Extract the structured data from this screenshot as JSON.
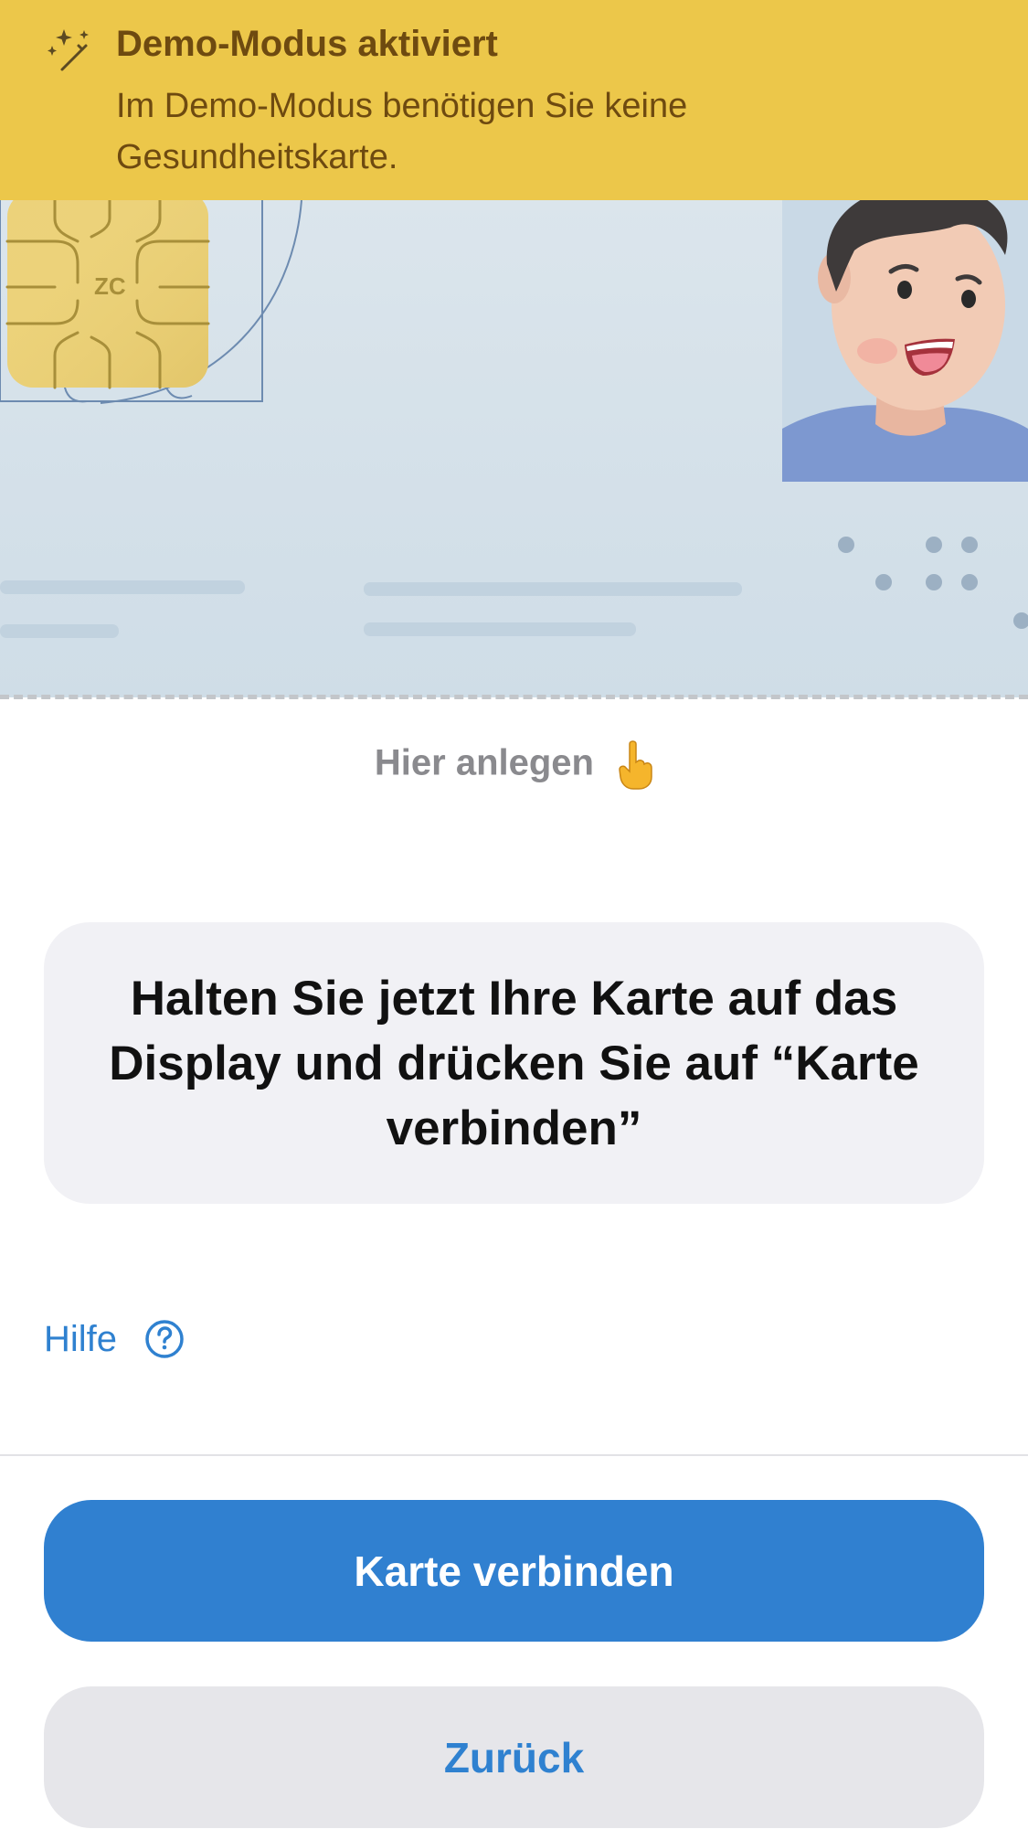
{
  "banner": {
    "icon": "magic-sparkles-icon",
    "title": "Demo-Modus aktiviert",
    "text": "Im Demo-Modus benötigen Sie keine Gesundheitskarte."
  },
  "card_illustration": {
    "icons": [
      "chip-icon",
      "portrait-avatar-icon",
      "braille-dots-icon"
    ]
  },
  "hint": {
    "label": "Hier anlegen",
    "icon": "pointing-hand-icon"
  },
  "instruction": {
    "text": "Halten Sie jetzt Ihre Karte auf das Display und drücken Sie auf “Karte verbinden”"
  },
  "help": {
    "label": "Hilfe",
    "icon": "question-circle-icon"
  },
  "buttons": {
    "connect_label": "Karte verbinden",
    "back_label": "Zurück"
  },
  "colors": {
    "banner": "#ECC74A",
    "banner_text": "#6E4A10",
    "accent": "#3080D0",
    "secondary_button": "#E6E6EA",
    "instruction_box": "#F1F1F5"
  }
}
